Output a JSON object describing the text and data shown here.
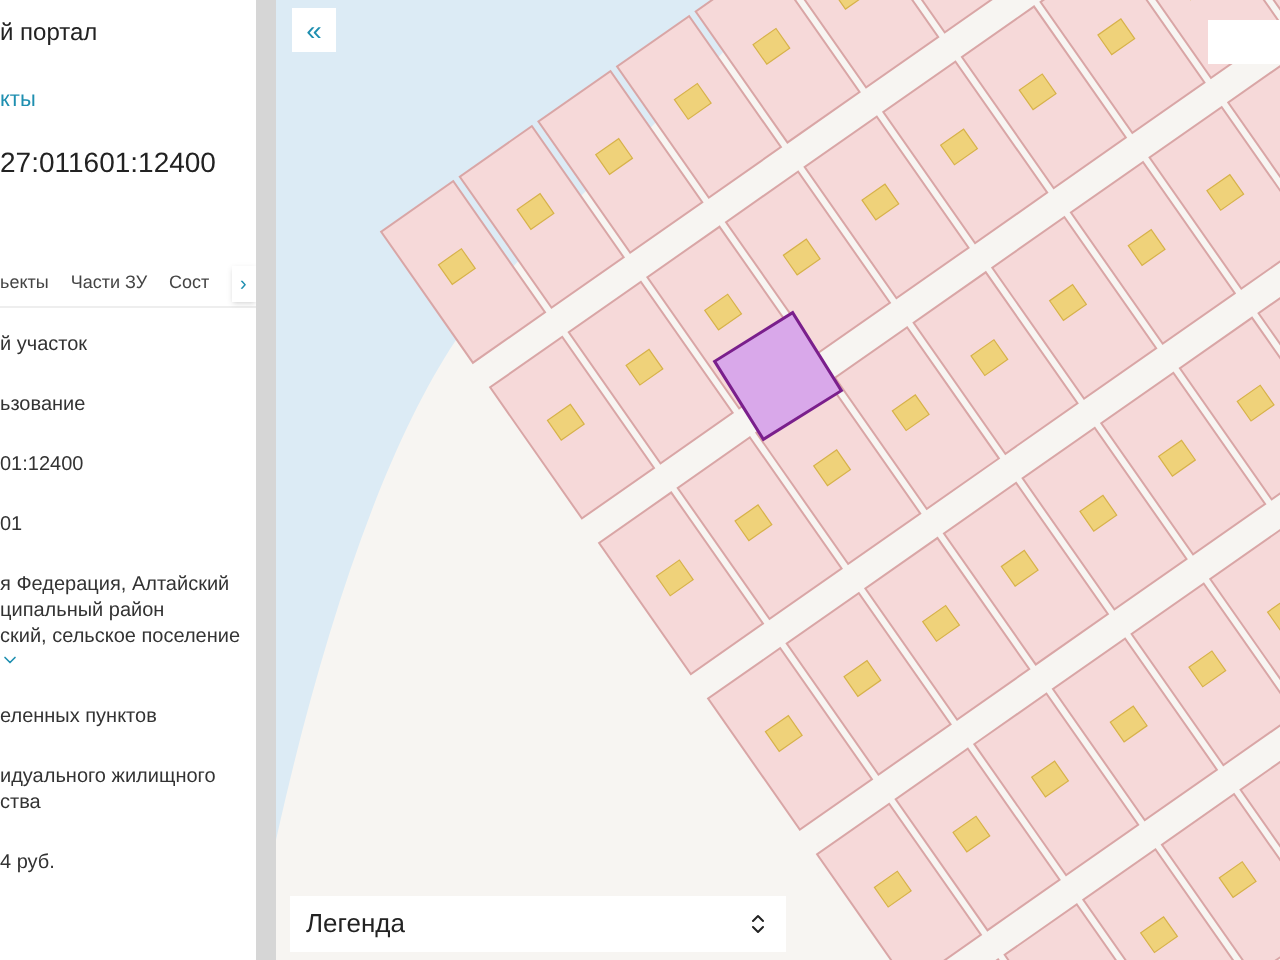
{
  "panel": {
    "header": "й портал",
    "link": "кты",
    "cadastral_number": "27:011601:12400",
    "tabs": [
      {
        "label": "ьекты",
        "selected": false
      },
      {
        "label": "Части ЗУ",
        "selected": false
      },
      {
        "label": "Сост",
        "selected": false
      }
    ],
    "tabs_next": "›",
    "fields": [
      {
        "lines": [
          "й участок"
        ]
      },
      {
        "lines": [
          "ьзование"
        ]
      },
      {
        "lines": [
          "01:12400"
        ]
      },
      {
        "lines": [
          "01"
        ]
      },
      {
        "lines": [
          "я Федерация, Алтайский",
          "ципальный район",
          "ский, сельское поселение"
        ],
        "expandable": true
      },
      {
        "lines": [
          "еленных пунктов"
        ]
      },
      {
        "lines": [
          "идуального жилищного",
          "ства"
        ]
      },
      {
        "lines": [
          "4 руб."
        ]
      }
    ]
  },
  "map": {
    "collapse_button": "«",
    "legend": {
      "label": "Легенда"
    }
  }
}
